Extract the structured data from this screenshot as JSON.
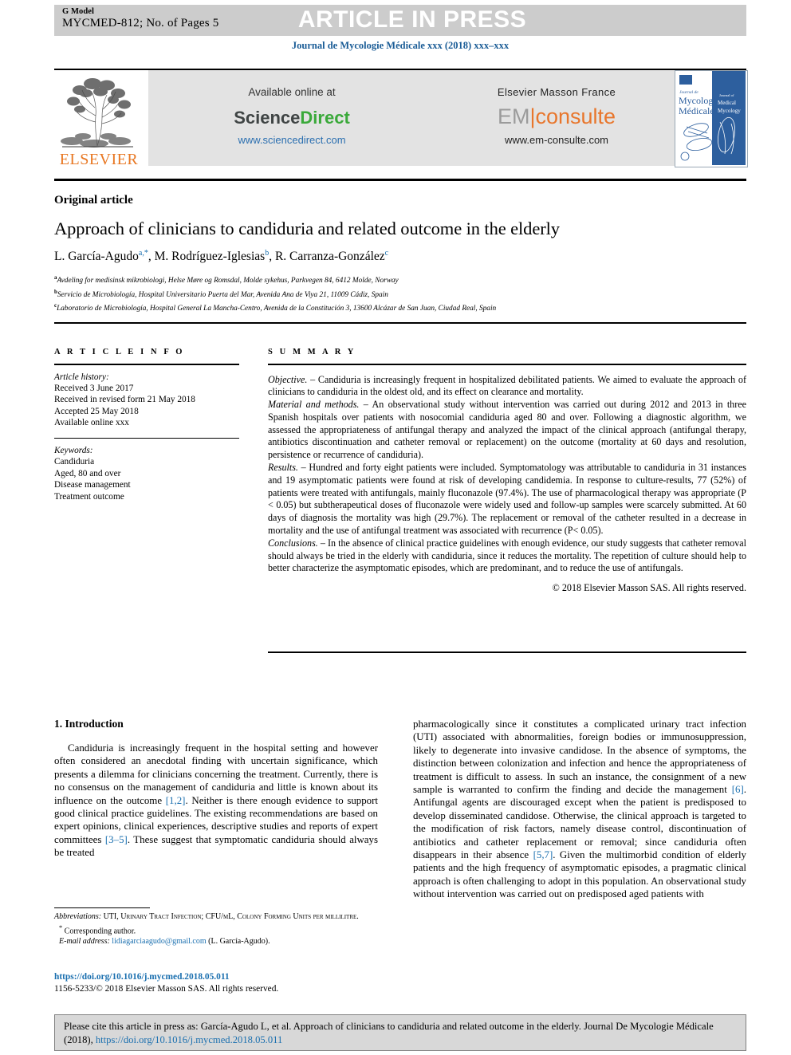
{
  "banner": {
    "g_model": "G Model",
    "manuscript_id": "MYCMED-812; No. of Pages 5",
    "status": "ARTICLE IN PRESS"
  },
  "journal_line": "Journal de Mycologie Médicale xxx (2018) xxx–xxx",
  "masthead": {
    "elsevier_wordmark": "ELSEVIER",
    "sciencedirect": {
      "available_online": "Available online at",
      "logo_part1": "Science",
      "logo_part2": "Direct",
      "url": "www.sciencedirect.com"
    },
    "em_consulte": {
      "publisher": "Elsevier Masson France",
      "logo_part1": "EM",
      "logo_divider": "|",
      "logo_part2": "consulte",
      "url": "www.em-consulte.com"
    },
    "cover": {
      "line1": "Journal de",
      "line2": "Mycologie",
      "line3": "Médicale",
      "side1": "Journal of",
      "side2": "Medical",
      "side3": "Mycology"
    }
  },
  "article": {
    "kind": "Original article",
    "title": "Approach of clinicians to candiduria and related outcome in the elderly",
    "authors": [
      {
        "name": "L. García-Agudo",
        "marks": "a,*"
      },
      {
        "name": "M. Rodríguez-Iglesias",
        "marks": "b"
      },
      {
        "name": "R. Carranza-González",
        "marks": "c"
      }
    ],
    "affiliations": [
      {
        "mark": "a",
        "text": "Avdeling for medisinsk mikrobiologi, Helse Møre og Romsdal, Molde sykehus, Parkvegen 84, 6412 Molde, Norway"
      },
      {
        "mark": "b",
        "text": "Servicio de Microbiología, Hospital Universitario Puerta del Mar, Avenida Ana de Viya 21, 11009 Cádiz, Spain"
      },
      {
        "mark": "c",
        "text": "Laboratorio de Microbiología, Hospital General La Mancha-Centro, Avenida de la Constitución 3, 13600 Alcázar de San Juan, Ciudad Real, Spain"
      }
    ]
  },
  "info": {
    "heading": "A R T I C L E   I N F O",
    "history_label": "Article history:",
    "history": [
      "Received 3 June 2017",
      "Received in revised form 21 May 2018",
      "Accepted 25 May 2018",
      "Available online xxx"
    ],
    "keywords_label": "Keywords:",
    "keywords": [
      "Candiduria",
      "Aged, 80 and over",
      "Disease management",
      "Treatment outcome"
    ]
  },
  "summary": {
    "heading": "S U M M A R Y",
    "sections": [
      {
        "lead": "Objective. –",
        "text": " Candiduria is increasingly frequent in hospitalized debilitated patients. We aimed to evaluate the approach of clinicians to candiduria in the oldest old, and its effect on clearance and mortality."
      },
      {
        "lead": "Material and methods. –",
        "text": " An observational study without intervention was carried out during 2012 and 2013 in three Spanish hospitals over patients with nosocomial candiduria aged 80 and over. Following a diagnostic algorithm, we assessed the appropriateness of antifungal therapy and analyzed the impact of the clinical approach (antifungal therapy, antibiotics discontinuation and catheter removal or replacement) on the outcome (mortality at 60 days and resolution, persistence or recurrence of candiduria)."
      },
      {
        "lead": "Results. –",
        "text": " Hundred and forty eight patients were included. Symptomatology was attributable to candiduria in 31 instances and 19 asymptomatic patients were found at risk of developing candidemia. In response to culture-results, 77 (52%) of patients were treated with antifungals, mainly fluconazole (97.4%). The use of pharmacological therapy was appropriate (P < 0.05) but subtherapeutical doses of fluconazole were widely used and follow-up samples were scarcely submitted. At 60 days of diagnosis the mortality was high (29.7%). The replacement or removal of the catheter resulted in a decrease in mortality and the use of antifungal treatment was associated with recurrence (P< 0.05)."
      },
      {
        "lead": "Conclusions. –",
        "text": " In the absence of clinical practice guidelines with enough evidence, our study suggests that catheter removal should always be tried in the elderly with candiduria, since it reduces the mortality. The repetition of culture should help to better characterize the asymptomatic episodes, which are predominant, and to reduce the use of antifungals."
      }
    ],
    "copyright": "© 2018 Elsevier Masson SAS. All rights reserved."
  },
  "body": {
    "intro_heading": "1. Introduction",
    "left_paragraph_1": "Candiduria is increasingly frequent in the hospital setting and however often considered an anecdotal finding with uncertain significance, which presents a dilemma for clinicians concerning the treatment. Currently, there is no consensus on the management of candiduria and little is known about its influence on the outcome ",
    "left_ref_1": "[1,2]",
    "left_paragraph_1b": ". Neither is there enough evidence to support good clinical practice guidelines. The existing recommendations are based on expert opinions, clinical experiences, descriptive studies and reports of expert committees ",
    "left_ref_2": "[3–5]",
    "left_paragraph_1c": ". These suggest that symptomatic candiduria should always be treated",
    "right_paragraph_1a": "pharmacologically since it constitutes a complicated urinary tract infection (UTI) associated with abnormalities, foreign bodies or immunosuppression, likely to degenerate into invasive candidose. In the absence of symptoms, the distinction between colonization and infection and hence the appropriateness of treatment is difficult to assess. In such an instance, the consignment of a new sample is warranted to confirm the finding and decide the management ",
    "right_ref_1": "[6]",
    "right_paragraph_1b": ". Antifungal agents are discouraged except when the patient is predisposed to develop disseminated candidose. Otherwise, the clinical approach is targeted to the modification of risk factors, namely disease control, discontinuation of antibiotics and catheter replacement or removal; since candiduria often disappears in their absence ",
    "right_ref_2": "[5,7]",
    "right_paragraph_1c": ". Given the multimorbid condition of elderly patients and the high frequency of asymptomatic episodes, a pragmatic clinical approach is often challenging to adopt in this population. An observational study without intervention was carried out on predisposed aged patients with"
  },
  "footnotes": {
    "abbrev_label": "Abbreviations:",
    "abbrev_text": " UTI, Urinary Tract Infection; CFU/mL, Colony Forming Units per millilitre.",
    "corresponding_marker": "*",
    "corresponding_text": "Corresponding author.",
    "email_label": "E-mail address:",
    "email": "lidiagarciaagudo@gmail.com",
    "email_owner": "(L. García-Agudo).",
    "doi": "https://doi.org/10.1016/j.mycmed.2018.05.011",
    "issn_line": "1156-5233/© 2018 Elsevier Masson SAS. All rights reserved."
  },
  "footer": {
    "cite_prefix": "Please cite this article in press as: García-Agudo L, et al. Approach of clinicians to candiduria and related outcome in the elderly. Journal De Mycologie Médicale (2018), ",
    "cite_doi": "https://doi.org/10.1016/j.mycmed.2018.05.011"
  },
  "colors": {
    "link_blue": "#1a6faf",
    "elsevier_orange": "#e87722",
    "sciencedirect_green": "#3aa93a",
    "em_orange": "#e8762c",
    "banner_grey": "#cccccc",
    "panel_grey": "#e3e3e3",
    "footer_grey": "#d8d8d8"
  }
}
